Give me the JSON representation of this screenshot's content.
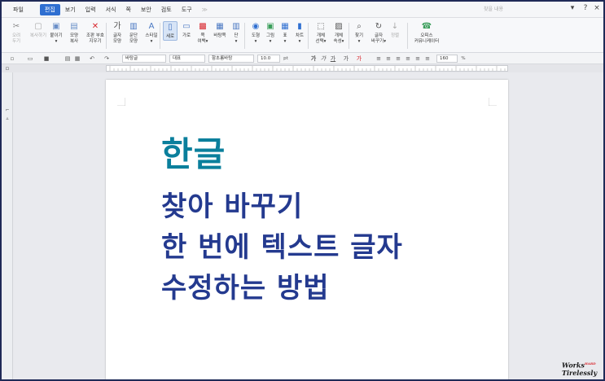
{
  "menu": {
    "items": [
      "파일",
      "편집",
      "보기",
      "입력",
      "서식",
      "쪽",
      "보안",
      "검토",
      "도구"
    ],
    "active_index": 1,
    "search_placeholder": "찾을 내용"
  },
  "ribbon": {
    "groups": [
      {
        "id": "cut",
        "l1": "오려",
        "l2": "두기",
        "dim": true
      },
      {
        "id": "copy",
        "l1": "복사하기",
        "l2": "",
        "dim": true
      },
      {
        "id": "paste",
        "l1": "붙이기",
        "l2": "▾",
        "dim": false
      },
      {
        "id": "format-copy",
        "l1": "모양",
        "l2": "복사",
        "dim": false
      },
      {
        "id": "clear-format",
        "l1": "조판 부호",
        "l2": "지우기",
        "dim": false
      },
      {
        "id": "char-shape",
        "l1": "글자",
        "l2": "모양",
        "dim": false
      },
      {
        "id": "para-shape",
        "l1": "문단",
        "l2": "모양",
        "dim": false
      },
      {
        "id": "style",
        "l1": "스타일",
        "l2": "▾",
        "dim": false
      },
      {
        "id": "vertical",
        "l1": "세로",
        "l2": "",
        "dim": false
      },
      {
        "id": "horizontal",
        "l1": "가로",
        "l2": "",
        "dim": false
      },
      {
        "id": "page-margin",
        "l1": "쪽",
        "l2": "여백▾",
        "dim": false
      },
      {
        "id": "multi-col",
        "l1": "바탕쪽",
        "l2": "",
        "dim": false
      },
      {
        "id": "column",
        "l1": "단",
        "l2": "▾",
        "dim": false
      },
      {
        "id": "shape",
        "l1": "도형",
        "l2": "▾",
        "dim": false
      },
      {
        "id": "picture",
        "l1": "그림",
        "l2": "▾",
        "dim": false
      },
      {
        "id": "table",
        "l1": "표",
        "l2": "▾",
        "dim": false
      },
      {
        "id": "chart",
        "l1": "차트",
        "l2": "▾",
        "dim": false
      },
      {
        "id": "obj-select",
        "l1": "개체",
        "l2": "선택▾",
        "dim": false
      },
      {
        "id": "obj-props",
        "l1": "개체",
        "l2": "속성▾",
        "dim": false
      },
      {
        "id": "find",
        "l1": "찾기",
        "l2": "▾",
        "dim": false
      },
      {
        "id": "replace",
        "l1": "글자",
        "l2": "바꾸기▾",
        "dim": false
      },
      {
        "id": "sort",
        "l1": "정렬",
        "l2": "",
        "dim": true
      },
      {
        "id": "office",
        "l1": "오피스",
        "l2": "커뮤니케이터",
        "dim": false
      }
    ]
  },
  "toolbar2": {
    "style_value": "바탕글",
    "lang_value": "대표",
    "font_value": "함초롬바탕",
    "size_value": "10.0",
    "size_unit": "pt",
    "zoom_value": "160",
    "zoom_unit": "%"
  },
  "document": {
    "line1": "한글",
    "line2": "찾아 바꾸기",
    "line3": "한 번에 텍스트 글자",
    "line4": "수정하는 방법"
  },
  "watermark": {
    "line1": "Works",
    "super": "HARD",
    "line2": "Tirelessly"
  },
  "colors": {
    "accent": "#2f6fd1",
    "title_teal": "#0a7f9c",
    "title_navy": "#243a8f",
    "frame": "#1f2a57"
  }
}
